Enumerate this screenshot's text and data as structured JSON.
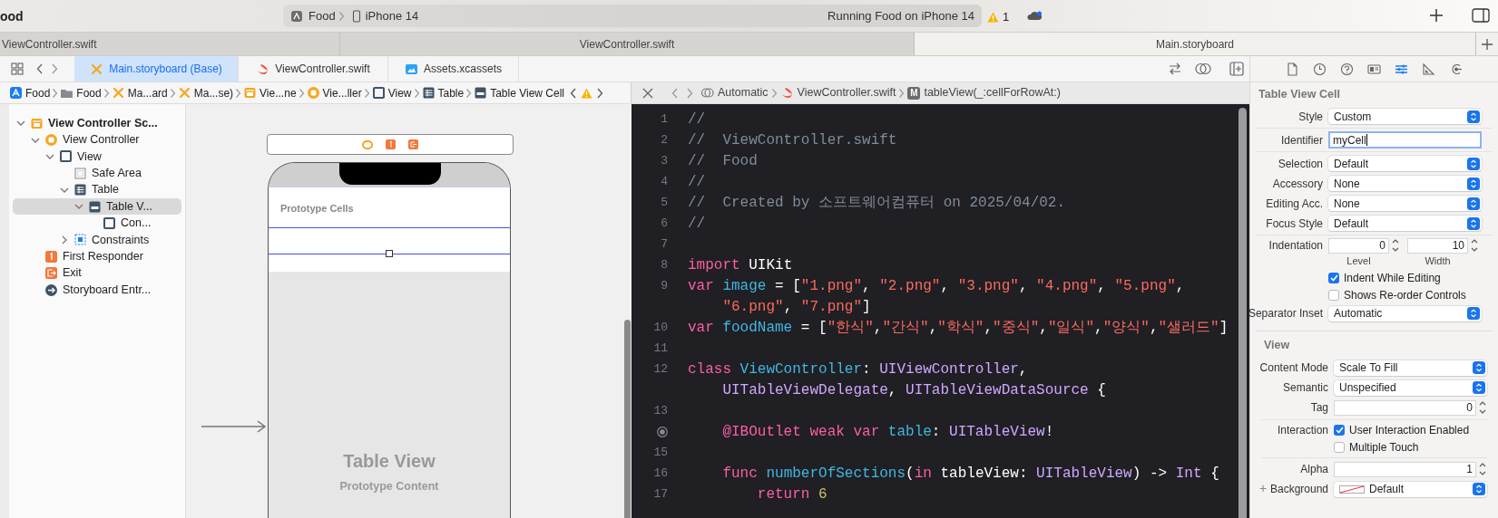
{
  "window": {
    "title": "ood"
  },
  "toolbar": {
    "scheme": {
      "target": "Food",
      "device": "iPhone 14"
    },
    "status": "Running Food on iPhone 14",
    "warnings": "1"
  },
  "window_tabs": [
    {
      "label": "ViewController.swift",
      "selected": false
    },
    {
      "label": "ViewController.swift",
      "selected": false
    },
    {
      "label": "Main.storyboard",
      "selected": true
    }
  ],
  "editor_tabs": [
    {
      "label": "Main.storyboard (Base)",
      "kind": "storyboard",
      "selected": true
    },
    {
      "label": "ViewController.swift",
      "kind": "swift",
      "selected": false
    },
    {
      "label": "Assets.xcassets",
      "kind": "assets",
      "selected": false
    }
  ],
  "jump_bar": [
    {
      "label": "Food",
      "kind": "app"
    },
    {
      "label": "Food",
      "kind": "folder"
    },
    {
      "label": "Ma...ard",
      "kind": "storyboard"
    },
    {
      "label": "Ma...se)",
      "kind": "storyboard"
    },
    {
      "label": "Vie...ne",
      "kind": "scene"
    },
    {
      "label": "Vie...ller",
      "kind": "controller"
    },
    {
      "label": "View",
      "kind": "view"
    },
    {
      "label": "Table",
      "kind": "table"
    },
    {
      "label": "Table View Cell",
      "kind": "cell"
    }
  ],
  "code_jump_bar": [
    {
      "label": "Automatic",
      "kind": "related"
    },
    {
      "label": "ViewController.swift",
      "kind": "swift"
    },
    {
      "label": "tableView(_:cellForRowAt:)",
      "kind": "method",
      "badge": "M"
    }
  ],
  "outline": [
    {
      "label": "View Controller Sc...",
      "kind": "scene",
      "expanded": true,
      "selected": false,
      "children": [
        {
          "label": "View Controller",
          "kind": "controller",
          "expanded": true,
          "selected": false,
          "children": [
            {
              "label": "View",
              "kind": "view",
              "expanded": true,
              "selected": false,
              "children": [
                {
                  "label": "Safe Area",
                  "kind": "safe-area",
                  "selected": false
                },
                {
                  "label": "Table",
                  "kind": "table",
                  "expanded": true,
                  "selected": false,
                  "children": [
                    {
                      "label": "Table V...",
                      "kind": "cell",
                      "expanded": true,
                      "selected": true,
                      "children": [
                        {
                          "label": "Con...",
                          "kind": "view",
                          "selected": false
                        }
                      ]
                    }
                  ]
                },
                {
                  "label": "Constraints",
                  "kind": "constraints",
                  "expanded": false,
                  "selected": false
                }
              ]
            }
          ]
        },
        {
          "label": "First Responder",
          "kind": "responder",
          "selected": false
        },
        {
          "label": "Exit",
          "kind": "exit",
          "selected": false
        },
        {
          "label": "Storyboard Entr...",
          "kind": "entry",
          "selected": false
        }
      ]
    }
  ],
  "canvas": {
    "section_header": "Prototype Cells",
    "placeholder_title": "Table View",
    "placeholder_subtitle": "Prototype Content"
  },
  "code": [
    {
      "kind": "numbered",
      "number": "1",
      "tokens": [
        {
          "text": "//",
          "kind": "comment"
        }
      ]
    },
    {
      "kind": "numbered",
      "number": "2",
      "tokens": [
        {
          "text": "//  ViewController.swift",
          "kind": "comment"
        }
      ]
    },
    {
      "kind": "numbered",
      "number": "3",
      "tokens": [
        {
          "text": "//  Food",
          "kind": "comment"
        }
      ]
    },
    {
      "kind": "numbered",
      "number": "4",
      "tokens": [
        {
          "text": "//",
          "kind": "comment"
        }
      ]
    },
    {
      "kind": "numbered",
      "number": "5",
      "tokens": [
        {
          "text": "//  Created by 소프트웨어컴퓨터 on 2025/04/02.",
          "kind": "comment"
        }
      ]
    },
    {
      "kind": "numbered",
      "number": "6",
      "tokens": [
        {
          "text": "//",
          "kind": "comment"
        }
      ]
    },
    {
      "kind": "numbered",
      "number": "7"
    },
    {
      "kind": "numbered",
      "number": "8",
      "tokens": [
        {
          "text": "import ",
          "kind": "keyword"
        },
        {
          "text": "UIKit",
          "kind": "plain"
        }
      ]
    },
    {
      "kind": "numbered",
      "number": "9",
      "tokens": [
        {
          "text": "var ",
          "kind": "keyword"
        },
        {
          "text": "image",
          "kind": "decl"
        },
        {
          "text": " = [",
          "kind": "plain"
        },
        {
          "text": "\"1.png\"",
          "kind": "string"
        },
        {
          "text": ", ",
          "kind": "plain"
        },
        {
          "text": "\"2.png\"",
          "kind": "string"
        },
        {
          "text": ", ",
          "kind": "plain"
        },
        {
          "text": "\"3.png\"",
          "kind": "string"
        },
        {
          "text": ", ",
          "kind": "plain"
        },
        {
          "text": "\"4.png\"",
          "kind": "string"
        },
        {
          "text": ", ",
          "kind": "plain"
        },
        {
          "text": "\"5.png\"",
          "kind": "string"
        },
        {
          "text": ",",
          "kind": "plain"
        }
      ],
      "wrap": [
        {
          "text": "\"6.png\"",
          "kind": "string"
        },
        {
          "text": ", ",
          "kind": "plain"
        },
        {
          "text": "\"7.png\"",
          "kind": "string"
        },
        {
          "text": "]",
          "kind": "plain"
        }
      ]
    },
    {
      "kind": "numbered",
      "number": "10",
      "tokens": [
        {
          "text": "var ",
          "kind": "keyword"
        },
        {
          "text": "foodName",
          "kind": "decl"
        },
        {
          "text": " = [",
          "kind": "plain"
        },
        {
          "text": "\"한식\"",
          "kind": "string"
        },
        {
          "text": ",",
          "kind": "plain"
        },
        {
          "text": "\"간식\"",
          "kind": "string"
        },
        {
          "text": ",",
          "kind": "plain"
        },
        {
          "text": "\"학식\"",
          "kind": "string"
        },
        {
          "text": ",",
          "kind": "plain"
        },
        {
          "text": "\"중식\"",
          "kind": "string"
        },
        {
          "text": ",",
          "kind": "plain"
        },
        {
          "text": "\"일식\"",
          "kind": "string"
        },
        {
          "text": ",",
          "kind": "plain"
        },
        {
          "text": "\"양식\"",
          "kind": "string"
        },
        {
          "text": ",",
          "kind": "plain"
        },
        {
          "text": "\"샐러드\"",
          "kind": "string"
        },
        {
          "text": "]",
          "kind": "plain"
        }
      ]
    },
    {
      "kind": "numbered",
      "number": "11"
    },
    {
      "kind": "numbered",
      "number": "12",
      "tokens": [
        {
          "text": "class ",
          "kind": "keyword"
        },
        {
          "text": "ViewController",
          "kind": "decl"
        },
        {
          "text": ": ",
          "kind": "plain"
        },
        {
          "text": "UIViewController",
          "kind": "type"
        },
        {
          "text": ",",
          "kind": "plain"
        }
      ],
      "wrap": [
        {
          "text": "UITableViewDelegate",
          "kind": "type"
        },
        {
          "text": ", ",
          "kind": "plain"
        },
        {
          "text": "UITableViewDataSource",
          "kind": "type"
        },
        {
          "text": " {",
          "kind": "plain"
        }
      ]
    },
    {
      "kind": "numbered",
      "number": "13"
    },
    {
      "kind": "outlet",
      "tokens": [
        {
          "text": "    @IBOutlet weak var ",
          "kind": "keyword"
        },
        {
          "text": "table",
          "kind": "decl"
        },
        {
          "text": ": ",
          "kind": "plain"
        },
        {
          "text": "UITableView",
          "kind": "type"
        },
        {
          "text": "!",
          "kind": "plain"
        }
      ]
    },
    {
      "kind": "numbered",
      "number": "15"
    },
    {
      "kind": "numbered",
      "number": "16",
      "tokens": [
        {
          "text": "    func ",
          "kind": "keyword"
        },
        {
          "text": "numberOfSections",
          "kind": "decl"
        },
        {
          "text": "(",
          "kind": "plain"
        },
        {
          "text": "in ",
          "kind": "keyword"
        },
        {
          "text": "tableView: ",
          "kind": "plain"
        },
        {
          "text": "UITableView",
          "kind": "type"
        },
        {
          "text": ") -> ",
          "kind": "plain"
        },
        {
          "text": "Int",
          "kind": "type"
        },
        {
          "text": " {",
          "kind": "plain"
        }
      ]
    },
    {
      "kind": "numbered",
      "number": "17",
      "tokens": [
        {
          "text": "        return ",
          "kind": "keyword"
        },
        {
          "text": "6",
          "kind": "number"
        }
      ]
    }
  ],
  "inspector": {
    "tabs": [
      {
        "selected": false
      },
      {
        "selected": false
      },
      {
        "selected": false
      },
      {
        "selected": false
      },
      {
        "selected": true
      },
      {
        "selected": false
      },
      {
        "selected": false
      }
    ],
    "sections": [
      {
        "title": "Table View Cell",
        "groups": [
          [
            {
              "kind": "popup",
              "label": "Style",
              "value": "Custom"
            }
          ],
          [
            {
              "kind": "field",
              "label": "Identifier",
              "value": "myCell",
              "focused": true
            }
          ],
          [
            {
              "kind": "popup",
              "label": "Selection",
              "value": "Default"
            },
            {
              "kind": "popup",
              "label": "Accessory",
              "value": "None"
            },
            {
              "kind": "popup",
              "label": "Editing Acc.",
              "value": "None"
            },
            {
              "kind": "popup",
              "label": "Focus Style",
              "value": "Default"
            }
          ],
          [
            {
              "kind": "stepper-pair",
              "label": "Indentation",
              "fields": [
                {
                  "value": "0",
                  "caption": "Level"
                },
                {
                  "value": "10",
                  "caption": "Width"
                }
              ]
            },
            {
              "kind": "checkbox",
              "text": "Indent While Editing",
              "checked": true
            },
            {
              "kind": "checkbox",
              "text": "Shows Re-order Controls",
              "checked": false
            },
            {
              "kind": "popup",
              "label": "Separator Inset",
              "value": "Automatic"
            }
          ]
        ]
      },
      {
        "title": "View",
        "groups": [
          [
            {
              "kind": "popup",
              "label": "Content Mode",
              "value": "Scale To Fill"
            },
            {
              "kind": "popup",
              "label": "Semantic",
              "value": "Unspecified"
            },
            {
              "kind": "stepper",
              "label": "Tag",
              "value": "0"
            }
          ],
          [
            {
              "kind": "checkbox",
              "label": "Interaction",
              "text": "User Interaction Enabled",
              "checked": true
            },
            {
              "kind": "checkbox",
              "text": "Multiple Touch",
              "checked": false
            }
          ],
          [
            {
              "kind": "stepper",
              "label": "Alpha",
              "value": "1"
            },
            {
              "kind": "color-popup",
              "prefix": "+",
              "label": "Background",
              "value": "Default"
            }
          ]
        ]
      }
    ]
  }
}
